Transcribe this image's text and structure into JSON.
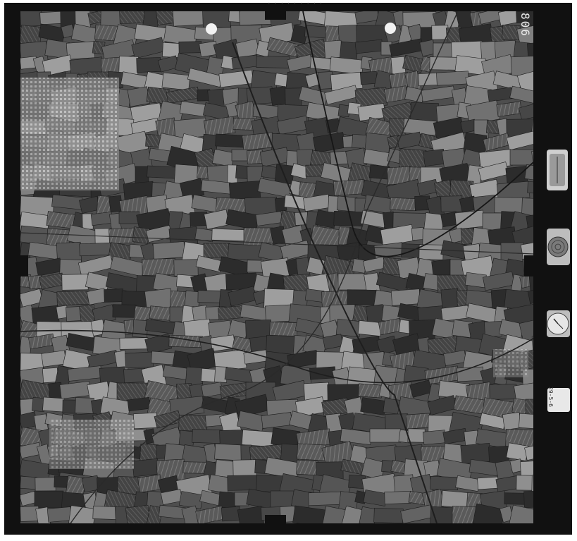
{
  "frame": {
    "number": "806",
    "header_strip": "· · · · · · · · ·",
    "date_label": "29-5-6"
  },
  "colors": {
    "border": "#111111",
    "paper": "#ffffff",
    "field_light": "#9a9a9a",
    "field_dark": "#2a2a2a",
    "urban": "#c8c8c8"
  },
  "instruments": [
    "compass-icon",
    "altimeter-icon",
    "clock-icon",
    "date-card-icon"
  ]
}
